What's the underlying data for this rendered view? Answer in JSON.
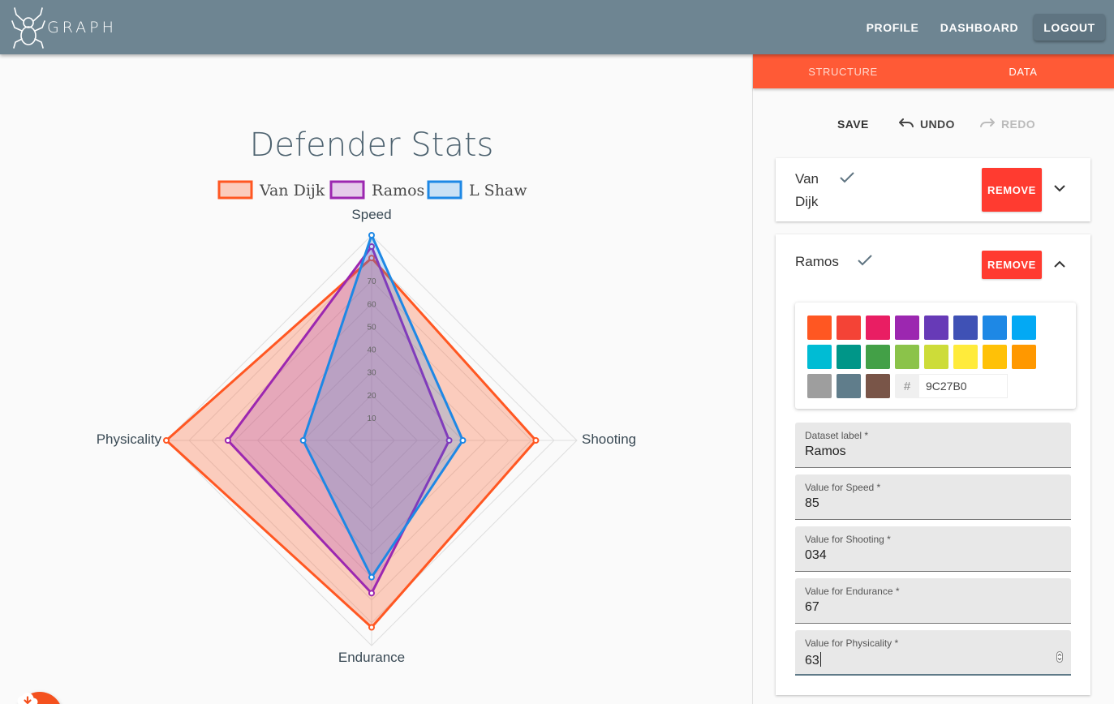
{
  "app": {
    "logo_text": "GRAPH"
  },
  "nav": {
    "profile": "PROFILE",
    "dashboard": "DASHBOARD",
    "logout": "LOGOUT"
  },
  "tabs": [
    {
      "label": "STRUCTURE",
      "active": false
    },
    {
      "label": "DATA",
      "active": true
    }
  ],
  "actions": {
    "save": "SAVE",
    "undo": "UNDO",
    "redo": "REDO"
  },
  "datasets": [
    {
      "name": "Van Dijk",
      "remove_label": "REMOVE",
      "expanded": false
    },
    {
      "name": "Ramos",
      "remove_label": "REMOVE",
      "expanded": true
    }
  ],
  "color_picker": {
    "colors": [
      "#ff5722",
      "#f44336",
      "#e91e63",
      "#9c27b0",
      "#673ab7",
      "#3f51b5",
      "#1e88e5",
      "#03a9f4",
      "#00bcd4",
      "#009688",
      "#43a047",
      "#8bc34a",
      "#cddc39",
      "#ffeb3b",
      "#ffc107",
      "#ff9800",
      "#9e9e9e",
      "#607d8b",
      "#795548"
    ],
    "hash": "#",
    "hex_value": "9C27B0"
  },
  "form": {
    "label_field": {
      "label": "Dataset label *",
      "value": "Ramos"
    },
    "speed": {
      "label": "Value for Speed *",
      "value": "85"
    },
    "shooting": {
      "label": "Value for Shooting *",
      "value": "034"
    },
    "endurance": {
      "label": "Value for Endurance *",
      "value": "67"
    },
    "physicality": {
      "label": "Value for Physicality *",
      "value": "63"
    }
  },
  "chart_data": {
    "type": "radar",
    "title": "Defender Stats",
    "axes": [
      "Speed",
      "Shooting",
      "Endurance",
      "Physicality"
    ],
    "scale_ticks": [
      10,
      20,
      30,
      40,
      50,
      60,
      70
    ],
    "r_max": 90,
    "legend_position": "top",
    "series": [
      {
        "name": "Van Dijk",
        "values": [
          80,
          72,
          82,
          90
        ],
        "color": "#ff5722",
        "fill": "rgba(255,87,34,0.28)"
      },
      {
        "name": "Ramos",
        "values": [
          85,
          34,
          67,
          63
        ],
        "color": "#9c27b0",
        "fill": "rgba(156,39,176,0.22)"
      },
      {
        "name": "L Shaw",
        "values": [
          90,
          40,
          60,
          30
        ],
        "color": "#1e88e5",
        "fill": "rgba(30,136,229,0.22)"
      }
    ]
  }
}
